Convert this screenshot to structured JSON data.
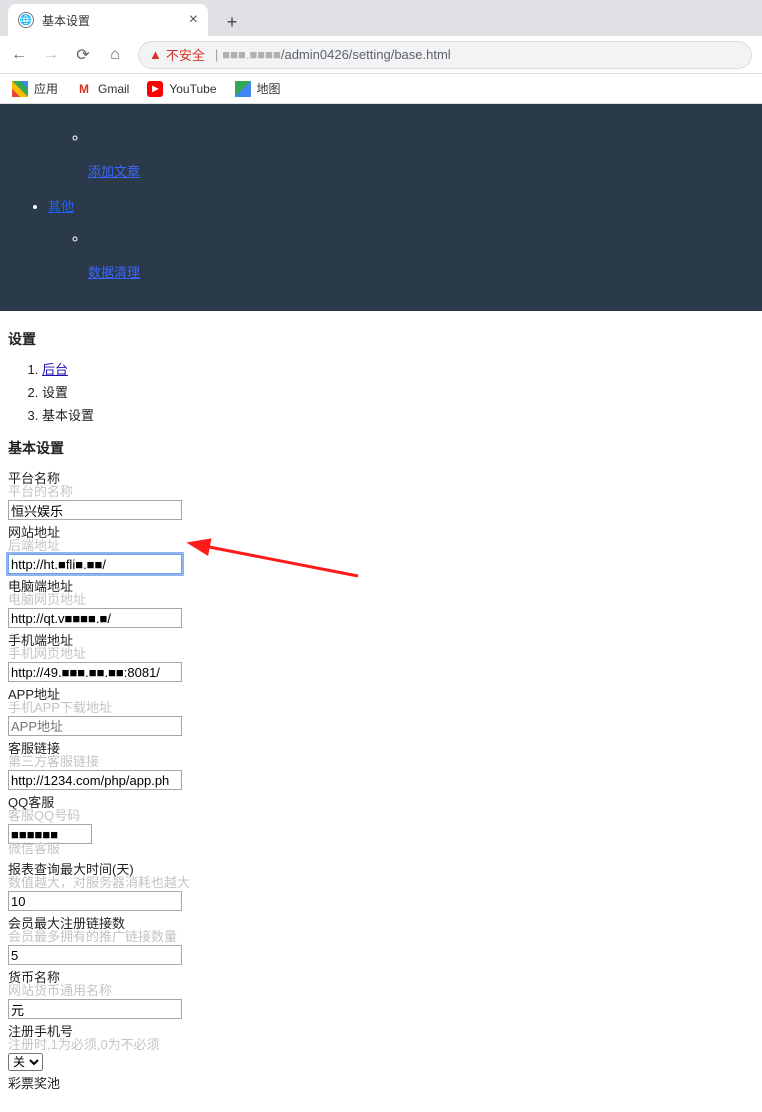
{
  "browser": {
    "tab_title": "基本设置",
    "insecure_label": "不安全",
    "url_display": "/admin0426/setting/base.html",
    "bookmarks": {
      "apps": "应用",
      "gmail": "Gmail",
      "youtube": "YouTube",
      "maps": "地图"
    }
  },
  "darknav": {
    "item_add_article": "添加文章",
    "category_other": "其他",
    "item_data_clean": "数据清理"
  },
  "page": {
    "heading": "设置",
    "crumb1": "后台",
    "crumb2": "设置",
    "crumb3": "基本设置",
    "subheading": "基本设置"
  },
  "form": {
    "platform_name": {
      "label": "平台名称",
      "sub": "平台的名称",
      "value": "恒兴娱乐"
    },
    "site_url": {
      "label": "网站地址",
      "sub": "后端地址",
      "value": "http://ht.■fli■.■■/"
    },
    "pc_url": {
      "label": "电脑端地址",
      "sub": "电脑网页地址",
      "value": "http://qt.v■■■■.■/"
    },
    "mobile_url": {
      "label": "手机端地址",
      "sub": "手机网页地址",
      "value": "http://49.■■■.■■.■■:8081/"
    },
    "app_url": {
      "label": "APP地址",
      "sub": "手机APP下载地址",
      "value": "",
      "placeholder": "APP地址"
    },
    "kefu_url": {
      "label": "客服链接",
      "sub": "第三方客服链接",
      "value": "http://1234.com/php/app.ph"
    },
    "qq_kefu": {
      "label": "QQ客服",
      "sub": "客服QQ号码",
      "value": "■■■■■■",
      "sub2": "微信客服"
    },
    "report_days": {
      "label": "报表查询最大时间(天)",
      "sub": "数值越大，对服务器消耗也越大",
      "value": "10"
    },
    "max_reg_links": {
      "label": "会员最大注册链接数",
      "sub": "会员最多拥有的推广链接数量",
      "value": "5"
    },
    "currency": {
      "label": "货币名称",
      "sub": "网站货币通用名称",
      "value": "元"
    },
    "reg_phone": {
      "label": "注册手机号",
      "sub": "注册时,1为必须,0为不必须",
      "selected": "关"
    },
    "lottery_pool": {
      "label": "彩票奖池"
    }
  }
}
